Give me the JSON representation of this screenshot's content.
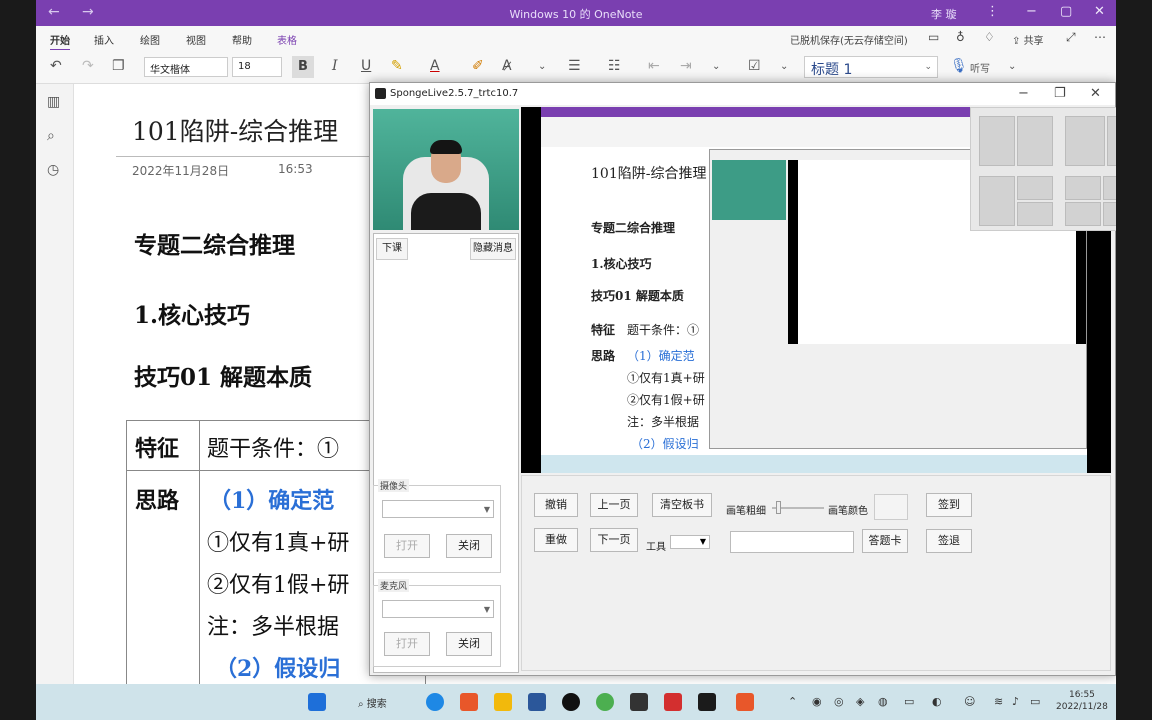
{
  "onenote": {
    "window_title": "Windows 10 的 OneNote",
    "user": "李 璇",
    "tabs": [
      "开始",
      "插入",
      "绘图",
      "视图",
      "帮助",
      "表格"
    ],
    "save_status": "已脱机保存(无云存储空间)",
    "share": "共享",
    "font_name": "华文楷体",
    "font_size": "18",
    "style": "标题 1",
    "dictate": "听写",
    "page": {
      "title": "101陷阱-综合推理",
      "date": "2022年11月28日",
      "time": "16:53",
      "heading1": "专题二综合推理",
      "heading2": "1.核心技巧",
      "heading3": "技巧01 解题本质",
      "table": {
        "r1_c1": "特征",
        "r1_c2": "题干条件：①",
        "r2_c1": "思路",
        "lines": [
          "（1）确定范",
          "①仅有1真+研",
          "②仅有1假+研",
          "注：多半根据",
          "（2）假设归"
        ]
      }
    }
  },
  "sponge": {
    "title": "SpongeLive2.5.7_trtc10.7",
    "side_buttons": [
      "下课",
      "隐藏消息"
    ],
    "mini_texts": {
      "title": "101陷阱-综合推理",
      "h1": "专题二综合推理",
      "h2": "1.核心技巧",
      "h3": "技巧01 解题本质",
      "t1": "特征",
      "t2": "题干条件：①",
      "t3": "思路",
      "t4": "（1）确定范",
      "t5": "①仅有1真+研",
      "t6": "②仅有1假+研",
      "t7": "注：多半根据",
      "t8": "（2）假设归"
    },
    "camera": {
      "label": "摄像头",
      "open": "打开",
      "close": "关闭"
    },
    "mic": {
      "label": "麦克风",
      "open": "打开",
      "close": "关闭"
    },
    "controls": {
      "undo": "撤销",
      "redo": "重做",
      "prev": "上一页",
      "next": "下一页",
      "clear": "清空板书",
      "tool": "工具",
      "pen_width": "画笔粗细",
      "pen_color": "画笔颜色",
      "answer": "答题卡",
      "sign_in": "签到",
      "sign_out": "签退"
    }
  },
  "taskbar": {
    "search": "搜索",
    "time": "16:55",
    "date": "2022/11/28"
  }
}
